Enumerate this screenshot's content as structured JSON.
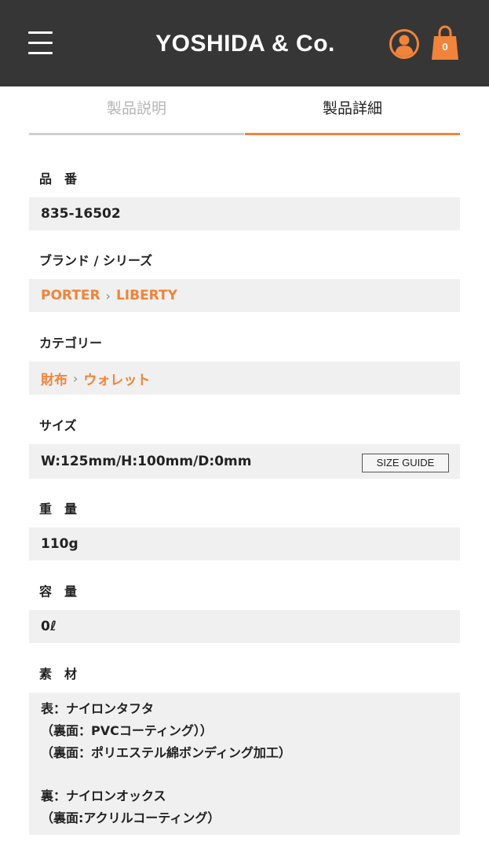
{
  "header": {
    "brand": "YOSHIDA & Co.",
    "cart_count": "0",
    "accent_color": "#f0843a",
    "background_color": "#363636"
  },
  "tabs": [
    {
      "label": "製品説明",
      "active": false
    },
    {
      "label": "製品詳細",
      "active": true
    }
  ],
  "specs": {
    "part_number": {
      "label": "品　番",
      "value": "835-16502"
    },
    "brand_series": {
      "label": "ブランド / シリーズ",
      "brand": "PORTER",
      "series": "LIBERTY",
      "separator": "›"
    },
    "category": {
      "label": "カテゴリー",
      "parent": "財布",
      "child": "ウォレット",
      "separator": "›"
    },
    "size": {
      "label": "サイズ",
      "value": "W:125mm/H:100mm/D:0mm",
      "guide_label": "SIZE GUIDE"
    },
    "weight": {
      "label": "重　量",
      "value": "110g"
    },
    "capacity": {
      "label": "容　量",
      "value": "0ℓ"
    },
    "material": {
      "label": "素　材",
      "outer": [
        "表：ナイロンタフタ",
        "（裏面：PVCコーティング））",
        "（裏面：ポリエステル綿ボンディング加工）"
      ],
      "inner": [
        "裏：ナイロンオックス",
        "（裏面:アクリルコーティング）"
      ]
    }
  }
}
